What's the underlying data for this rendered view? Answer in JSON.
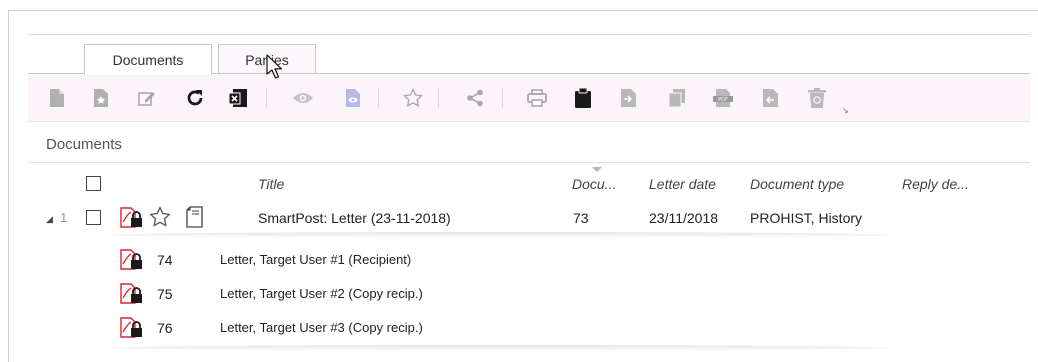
{
  "tabs": [
    {
      "label": "Documents",
      "active": true
    },
    {
      "label": "Parties",
      "active": false
    }
  ],
  "toolbar": {
    "icons": [
      "new-document-icon",
      "new-from-template-icon",
      "edit-icon",
      "refresh-icon",
      "export-excel-icon",
      "view-icon",
      "preview-icon",
      "favorite-icon",
      "share-icon",
      "print-icon",
      "clipboard-icon",
      "move-icon",
      "copy-icon",
      "pdf-icon",
      "restore-icon",
      "recycle-bin-icon"
    ]
  },
  "section": {
    "title": "Documents"
  },
  "columns": {
    "title": "Title",
    "docu": "Docu...",
    "letter_date": "Letter date",
    "document_type": "Document type",
    "reply_date": "Reply de..."
  },
  "main_row": {
    "row_number": "1",
    "title": "SmartPost: Letter (23-11-2018)",
    "docu": "73",
    "letter_date": "23/11/2018",
    "document_type": "PROHIST, History"
  },
  "sub_rows": [
    {
      "number": "74",
      "title": "Letter, Target User #1 (Recipient)"
    },
    {
      "number": "75",
      "title": "Letter, Target User #2 (Copy recip.)"
    },
    {
      "number": "76",
      "title": "Letter, Target User #3 (Copy recip.)"
    }
  ],
  "colors": {
    "toolbar_bg": "#fbf4fb",
    "icon_gray": "#a9a9a9",
    "icon_dark": "#1a1a1a",
    "pdf_red": "#d9262c"
  }
}
